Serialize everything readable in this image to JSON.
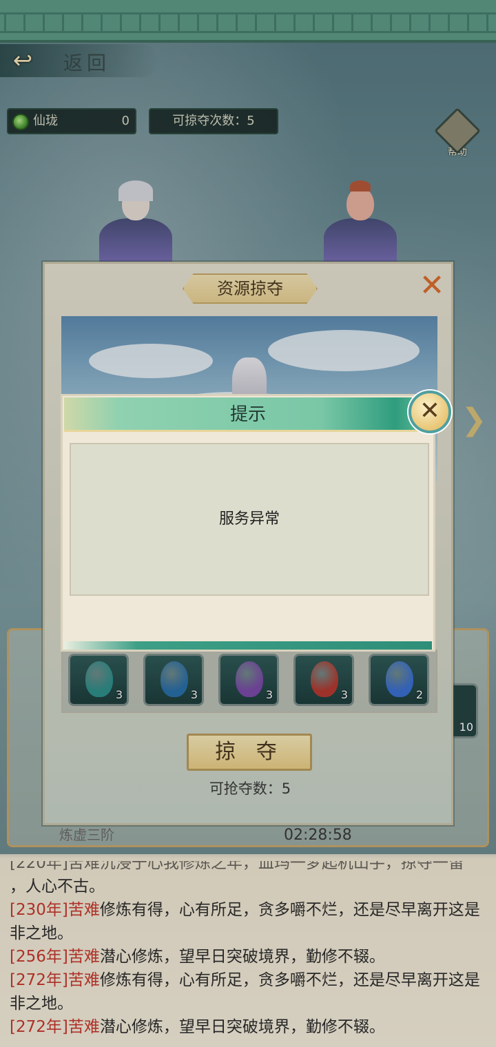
{
  "header": {
    "back_label": "返回"
  },
  "resources": {
    "currency_label": "仙珑",
    "currency_value": "0",
    "plunder_times": "可掠夺次数：5"
  },
  "help": {
    "label": "帮助"
  },
  "main_dialog": {
    "title": "资源掠夺",
    "plunder_button": "掠 夺",
    "plunder_count": "可抢夺数：5",
    "items": [
      {
        "icon": "teal-gourd-icon",
        "count": "3",
        "color": "#2f8f8a"
      },
      {
        "icon": "blue-gourd-icon",
        "count": "3",
        "color": "#2a6fa8"
      },
      {
        "icon": "purple-gourd-icon",
        "count": "3",
        "color": "#7a4aa8"
      },
      {
        "icon": "red-gourd-icon",
        "count": "3",
        "color": "#b23a30"
      },
      {
        "icon": "blue-orb-icon",
        "count": "2",
        "color": "#3a6fd0"
      }
    ]
  },
  "side_item": {
    "count": "10"
  },
  "bottom": {
    "realm": "炼虚三阶",
    "timer": "02:28:58"
  },
  "log": {
    "partial_top": "[220年]苦难沉浸于心我修炼之年，血玛一梦起机山手，掠夺一留",
    "partial_tail": "，人心不古。",
    "entries": [
      {
        "year": "[230年]",
        "tag": "苦难",
        "text": "修炼有得，心有所足，贪多嚼不烂，还是尽早离开这是非之地。"
      },
      {
        "year": "[256年]",
        "tag": "苦难",
        "text": "潜心修炼，望早日突破境界，勤修不辍。"
      },
      {
        "year": "[272年]",
        "tag": "苦难",
        "text": "修炼有得，心有所足，贪多嚼不烂，还是尽早离开这是非之地。"
      },
      {
        "year": "[272年]",
        "tag": "苦难",
        "text": "潜心修炼，望早日突破境界，勤修不辍。"
      }
    ]
  },
  "alert": {
    "title": "提示",
    "message": "服务异常"
  },
  "colors": {
    "accent_teal": "#3d9f86",
    "log_highlight": "#c5372d",
    "close_orange": "#d96d2d"
  }
}
